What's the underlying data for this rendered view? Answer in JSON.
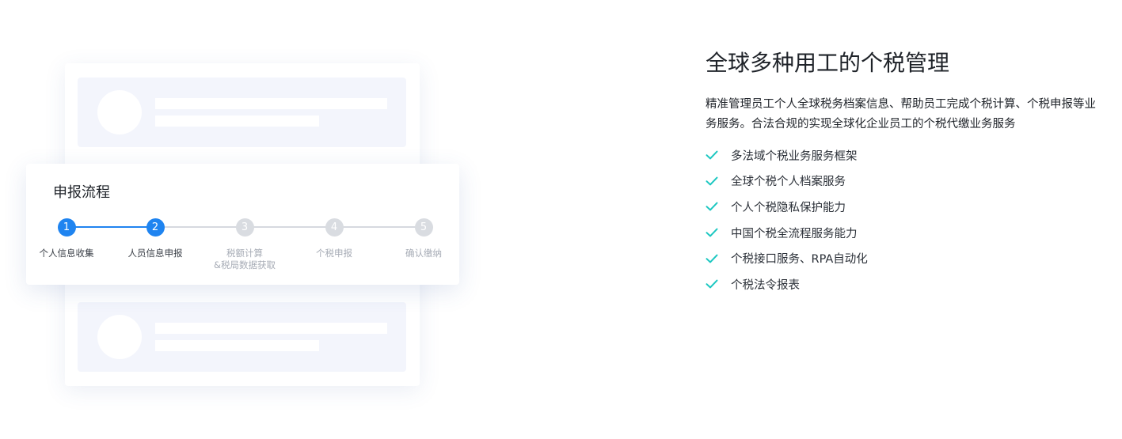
{
  "flow": {
    "title": "申报流程",
    "steps": [
      {
        "num": "1",
        "label": "个人信息收集",
        "active": true
      },
      {
        "num": "2",
        "label": "人员信息申报",
        "active": true
      },
      {
        "num": "3",
        "label": "税额计算\n&税局数据获取",
        "active": false
      },
      {
        "num": "4",
        "label": "个税申报",
        "active": false
      },
      {
        "num": "5",
        "label": "确认缴纳",
        "active": false
      }
    ]
  },
  "section": {
    "title": "全球多种用工的个税管理",
    "description": "精准管理员工个人全球税务档案信息、帮助员工完成个税计算、个税申报等业务服务。合法合规的实现全球化企业员工的个税代缴业务服务",
    "features": [
      "多法域个税业务服务框架",
      "全球个税个人档案服务",
      "个人个税隐私保护能力",
      "中国个税全流程服务能力",
      "个税接口服务、RPA自动化",
      "个税法令报表"
    ]
  },
  "colors": {
    "accent": "#1f84f0",
    "check": "#1cc7c1",
    "inactive": "#d9dce1",
    "skeleton": "#f3f5fc"
  },
  "icons": {
    "feature": "check-icon"
  }
}
